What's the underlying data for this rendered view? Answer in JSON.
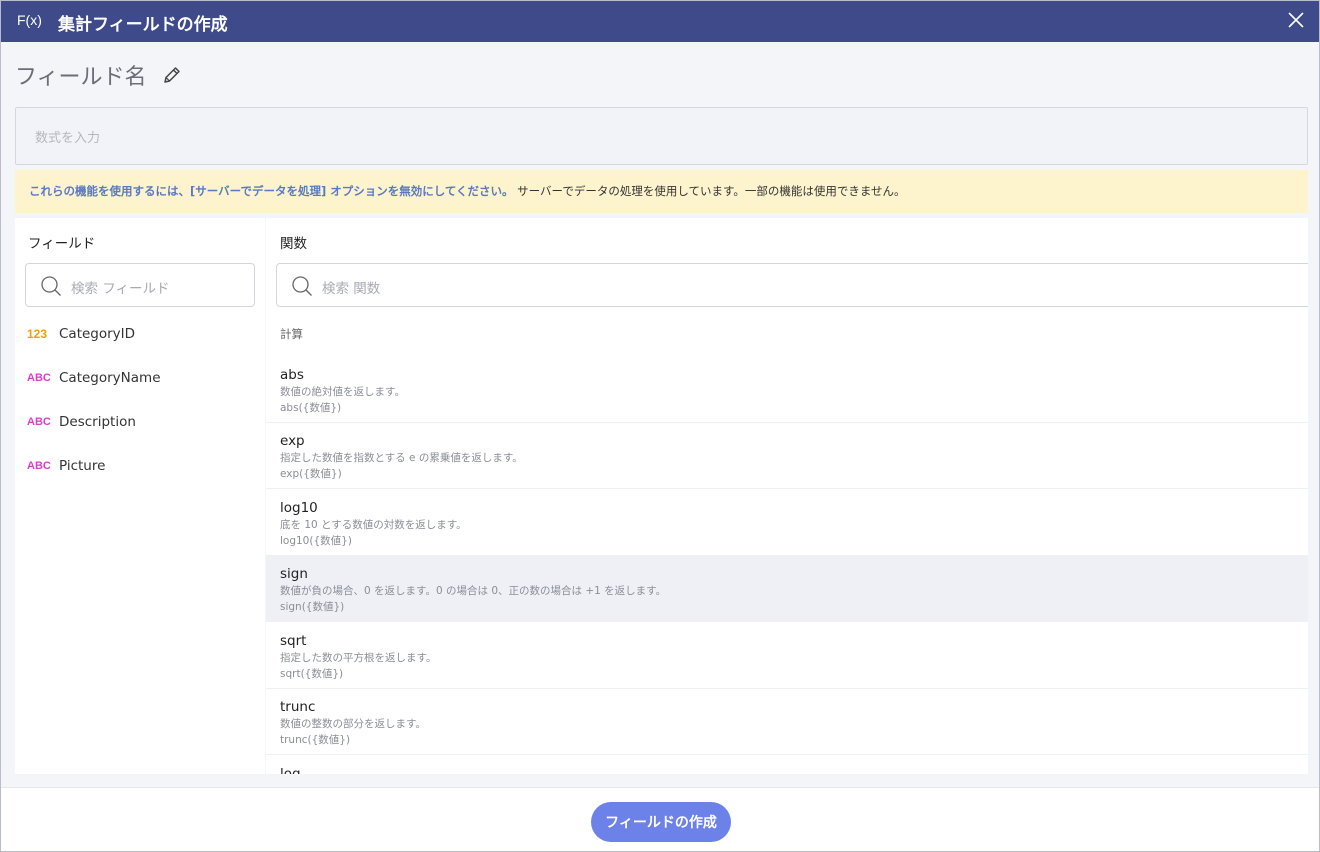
{
  "title_bar": {
    "fx_label": "F(x)",
    "title": "集計フィールドの作成",
    "close_icon": "close-icon"
  },
  "field_name": {
    "label": "フィールド名",
    "edit_icon": "pencil-icon"
  },
  "formula": {
    "placeholder": "数式を入力"
  },
  "warning": {
    "strong_text": "これらの機能を使用するには、[サーバーでデータを処理] オプションを無効にしてください。",
    "plain_text": "サーバーでデータの処理を使用しています。一部の機能は使用できません。",
    "background_color": "#fdf3cd",
    "strong_color": "#5a79c4"
  },
  "fields_panel": {
    "title": "フィールド",
    "search_placeholder": "検索 フィールド",
    "items": [
      {
        "badge": "123",
        "name": "CategoryID"
      },
      {
        "badge": "ABC",
        "name": "CategoryName"
      },
      {
        "badge": "ABC",
        "name": "Description"
      },
      {
        "badge": "ABC",
        "name": "Picture"
      }
    ]
  },
  "functions_panel": {
    "title": "関数",
    "search_placeholder": "検索 関数",
    "category": "計算",
    "items": [
      {
        "name": "abs",
        "description": "数値の絶対値を返します。",
        "signature": "abs({数値})"
      },
      {
        "name": "exp",
        "description": "指定した数値を指数とする e の累乗値を返します。",
        "signature": "exp({数値})"
      },
      {
        "name": "log10",
        "description": "底を 10 とする数値の対数を返します。",
        "signature": "log10({数値})"
      },
      {
        "name": "sign",
        "description": "数値が負の場合、0 を返します。0 の場合は 0、正の数の場合は +1 を返します。",
        "signature": "sign({数値})",
        "selected": true
      },
      {
        "name": "sqrt",
        "description": "指定した数の平方根を返します。",
        "signature": "sqrt({数値})"
      },
      {
        "name": "trunc",
        "description": "数値の整数の部分を返します。",
        "signature": "trunc({数値})"
      },
      {
        "name": "log",
        "description": "",
        "signature": ""
      }
    ]
  },
  "footer": {
    "create_button": "フィールドの作成",
    "button_color": "#6d82e8"
  },
  "colors": {
    "title_bar": "#3e4a8a",
    "number_badge": "#f0a000",
    "text_badge": "#d940c8"
  }
}
